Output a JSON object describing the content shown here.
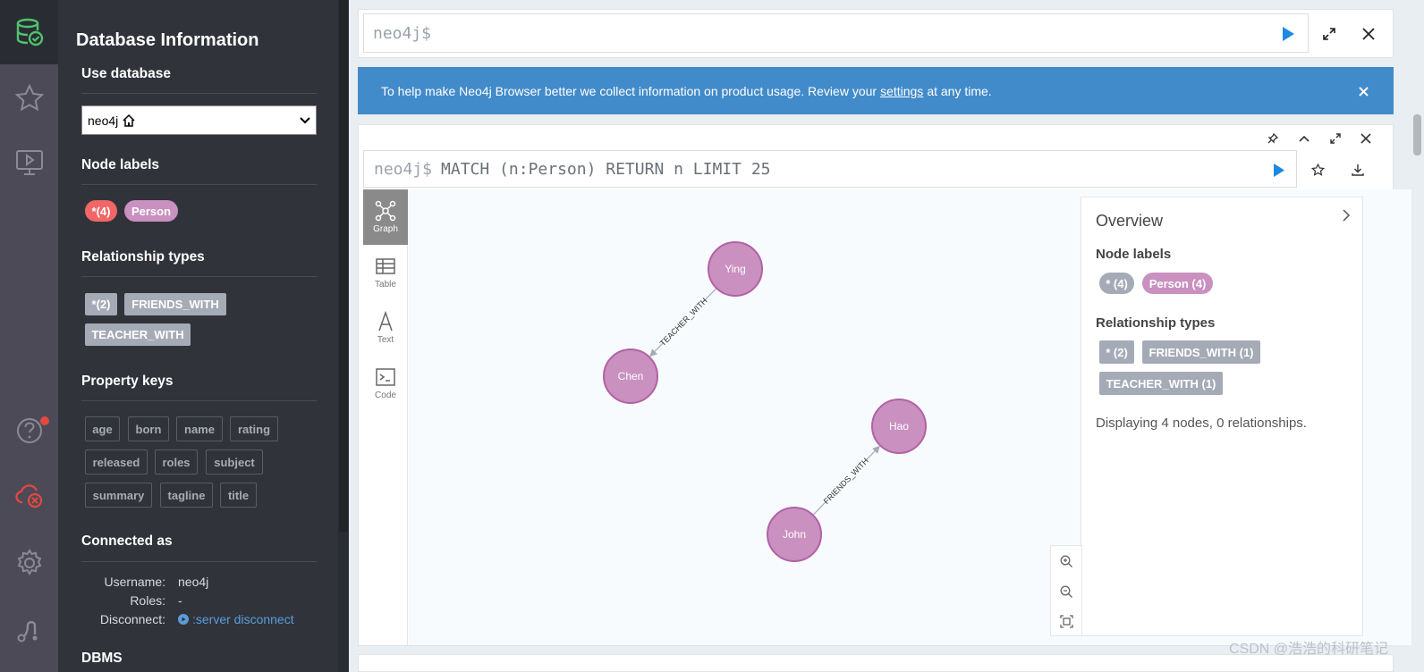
{
  "colors": {
    "accent": "#428bca",
    "node_person": "#c990c0",
    "node_stroke": "#b261a5",
    "all_label": "#f16667",
    "tag_gray": "#a5abb6",
    "run_blue": "#1e88e5"
  },
  "drawer": {
    "title": "Database Information",
    "use_database": {
      "title": "Use database",
      "selected": "neo4j",
      "home_icon": "home-icon"
    },
    "node_labels": {
      "title": "Node labels",
      "items": [
        "*(4)",
        "Person"
      ]
    },
    "relationship_types": {
      "title": "Relationship types",
      "items": [
        "*(2)",
        "FRIENDS_WITH",
        "TEACHER_WITH"
      ]
    },
    "property_keys": {
      "title": "Property keys",
      "items": [
        "age",
        "born",
        "name",
        "rating",
        "released",
        "roles",
        "subject",
        "summary",
        "tagline",
        "title"
      ]
    },
    "connected_as": {
      "title": "Connected as",
      "username_label": "Username:",
      "username": "neo4j",
      "roles_label": "Roles:",
      "roles": "-",
      "disconnect_label": "Disconnect:",
      "disconnect_cmd": ":server disconnect"
    },
    "dbms_title": "DBMS"
  },
  "main": {
    "top_editor": {
      "prompt": "neo4j$"
    },
    "banner": {
      "text_before": "To help make Neo4j Browser better we collect information on product usage. Review your",
      "link": "settings",
      "text_after": "at any time."
    },
    "result_frame": {
      "prompt": "neo4j$",
      "query": "MATCH (n:Person) RETURN n LIMIT 25",
      "tabs": [
        "Graph",
        "Table",
        "Text",
        "Code"
      ],
      "active_tab": "Graph"
    },
    "graph": {
      "nodes": [
        {
          "id": "ying",
          "caption": "Ying"
        },
        {
          "id": "chen",
          "caption": "Chen"
        },
        {
          "id": "hao",
          "caption": "Hao"
        },
        {
          "id": "john",
          "caption": "John"
        }
      ],
      "relationships": [
        {
          "from": "ying",
          "to": "chen",
          "type": "TEACHER_WITH"
        },
        {
          "from": "john",
          "to": "hao",
          "type": "FRIENDS_WITH"
        }
      ]
    },
    "overview": {
      "title": "Overview",
      "node_labels_title": "Node labels",
      "node_labels": [
        "* (4)",
        "Person (4)"
      ],
      "relationship_types_title": "Relationship types",
      "relationship_types": [
        "* (2)",
        "FRIENDS_WITH (1)",
        "TEACHER_WITH (1)"
      ],
      "status": "Displaying 4 nodes, 0 relationships."
    }
  },
  "watermark": "CSDN @浩浩的科研笔记"
}
